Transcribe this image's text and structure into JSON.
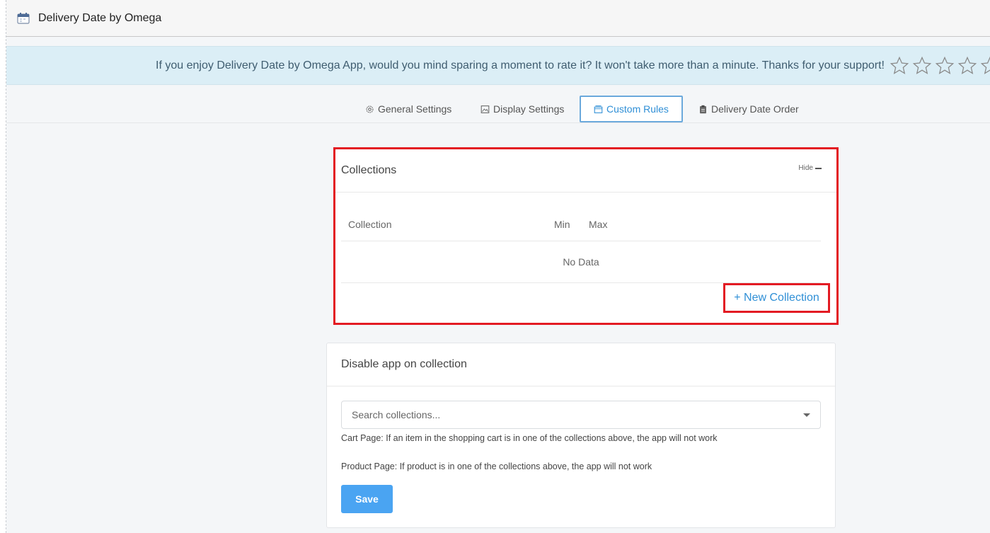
{
  "app": {
    "title": "Delivery Date by Omega"
  },
  "banner": {
    "text": "If you enjoy Delivery Date by Omega App, would you mind sparing a moment to rate it? It won't take more than a minute. Thanks for your support!",
    "rating_max": 5,
    "star_icon": "star-outline-icon"
  },
  "tabs": [
    {
      "label": "General Settings",
      "icon": "gear-icon",
      "active": false
    },
    {
      "label": "Display Settings",
      "icon": "image-icon",
      "active": false
    },
    {
      "label": "Custom Rules",
      "icon": "folder-icon",
      "active": true
    },
    {
      "label": "Delivery Date Order",
      "icon": "clipboard-icon",
      "active": false
    }
  ],
  "collections": {
    "title": "Collections",
    "hide_label": "Hide",
    "columns": [
      "Collection",
      "Min",
      "Max"
    ],
    "empty_text": "No Data",
    "new_button": "+ New Collection"
  },
  "disable": {
    "title": "Disable app on collection",
    "search_placeholder": "Search collections...",
    "cart_note": "Cart Page: If an item in the shopping cart is in one of the collections above, the app will not work",
    "product_note": "Product Page: If product is in one of the collections above, the app will not work",
    "save_label": "Save"
  },
  "colors": {
    "accent": "#2f8fd6",
    "button": "#4aa4f2",
    "highlight": "#e31b23",
    "banner_bg": "#dbeef6"
  }
}
